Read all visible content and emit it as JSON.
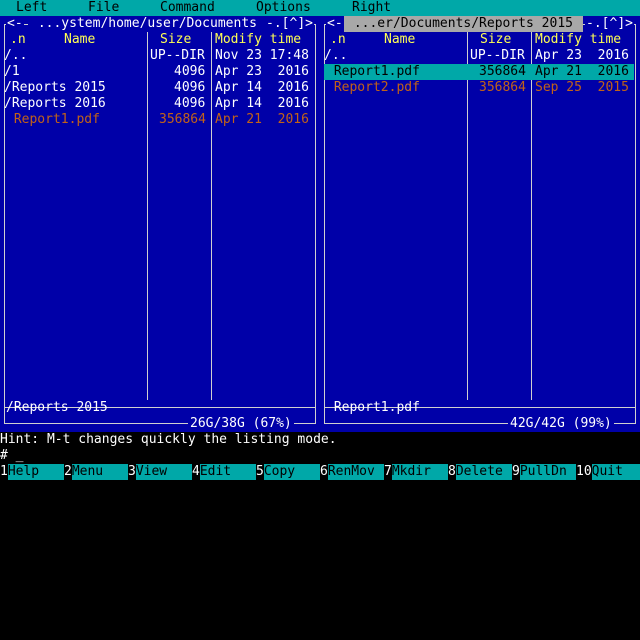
{
  "menu": [
    "Left",
    "File",
    "Command",
    "Options",
    "Right"
  ],
  "left_panel": {
    "nav_left": "<-",
    "path": " ...ystem/home/user/Documents ",
    "nav_right": "-.[^]>",
    "headers": {
      "n": ".n",
      "name": "Name",
      "size": "Size",
      "mtime": "Modify time"
    },
    "rows": [
      {
        "name": "/..",
        "size": "UP--DIR",
        "mtime": "Nov 23 17:48"
      },
      {
        "name": "/1",
        "size": "4096",
        "mtime": "Apr 23  2016"
      },
      {
        "name": "/Reports 2015",
        "size": "4096",
        "mtime": "Apr 14  2016"
      },
      {
        "name": "/Reports 2016",
        "size": "4096",
        "mtime": "Apr 14  2016"
      },
      {
        "name": " Report1.pdf",
        "size": "356864",
        "mtime": "Apr 21  2016"
      }
    ],
    "status": "/Reports 2015",
    "usage": "26G/38G (67%)"
  },
  "right_panel": {
    "nav_left": "<-",
    "path": " ...er/Documents/Reports 2015 ",
    "nav_right": "-.[^]>",
    "headers": {
      "n": ".n",
      "name": "Name",
      "size": "Size",
      "mtime": "Modify time"
    },
    "rows": [
      {
        "name": "/..",
        "size": "UP--DIR",
        "mtime": "Apr 23  2016"
      },
      {
        "name": " Report1.pdf",
        "size": "356864",
        "mtime": "Apr 21  2016"
      },
      {
        "name": " Report2.pdf",
        "size": "356864",
        "mtime": "Sep 25  2015"
      }
    ],
    "status": " Report1.pdf",
    "usage": "42G/42G (99%)"
  },
  "hint": "Hint: M-t changes quickly the listing mode.",
  "prompt": "# _",
  "fkeys": [
    {
      "num": "1",
      "label": "Help"
    },
    {
      "num": "2",
      "label": "Menu"
    },
    {
      "num": "3",
      "label": "View"
    },
    {
      "num": "4",
      "label": "Edit"
    },
    {
      "num": "5",
      "label": "Copy"
    },
    {
      "num": "6",
      "label": "RenMov"
    },
    {
      "num": "7",
      "label": "Mkdir"
    },
    {
      "num": "8",
      "label": "Delete"
    },
    {
      "num": "9",
      "label": "PullDn"
    },
    {
      "num": "10",
      "label": "Quit"
    }
  ],
  "colors": {
    "panel_bg": "#0000a8",
    "menu_bg": "#00a8a8",
    "header": "#ffff54",
    "archive_file": "#c26218",
    "selection": "#00a8a8"
  }
}
